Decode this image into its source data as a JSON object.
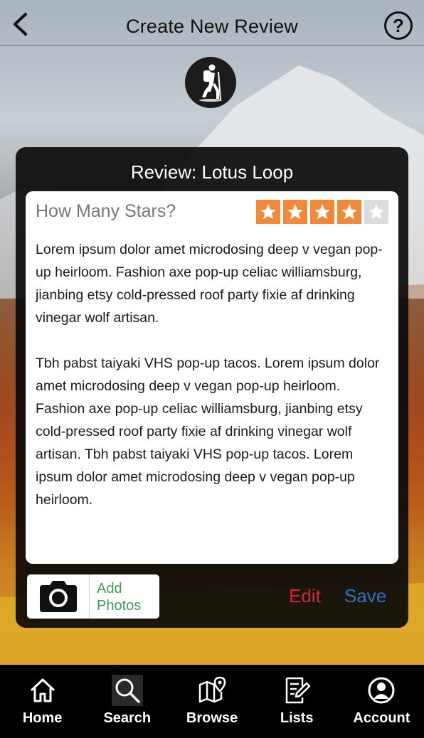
{
  "header": {
    "title": "Create New Review",
    "help_label": "?"
  },
  "card": {
    "title": "Review: Lotus Loop",
    "stars_label": "How Many Stars?",
    "rating": 4,
    "max_rating": 5,
    "paragraphs": [
      "Lorem ipsum dolor amet microdosing deep v vegan pop-up   heirloom. Fashion axe pop-up celiac williamsburg, jianbing etsy cold-pressed roof party fixie af drinking vinegar wolf artisan.",
      "Tbh pabst taiyaki VHS pop-up tacos. Lorem ipsum dolor amet microdosing deep v vegan pop-up heirloom. Fashion axe pop-up celiac williamsburg, jianbing etsy cold-pressed roof party fixie af drinking vinegar wolf artisan. Tbh pabst taiyaki VHS pop-up tacos. Lorem ipsum dolor amet microdosing deep v vegan pop-up heirloom."
    ],
    "add_photos_line1": "Add",
    "add_photos_line2": "Photos",
    "edit_label": "Edit",
    "save_label": "Save"
  },
  "nav": {
    "items": [
      {
        "label": "Home",
        "icon": "home-icon"
      },
      {
        "label": "Search",
        "icon": "search-icon"
      },
      {
        "label": "Browse",
        "icon": "map-icon"
      },
      {
        "label": "Lists",
        "icon": "list-edit-icon"
      },
      {
        "label": "Account",
        "icon": "account-icon"
      }
    ]
  },
  "colors": {
    "star_on": "#f08a3a",
    "star_off": "#dcdcdc",
    "edit": "#d8252f",
    "save": "#2f6fc6",
    "add_photos": "#3f9a5e"
  }
}
